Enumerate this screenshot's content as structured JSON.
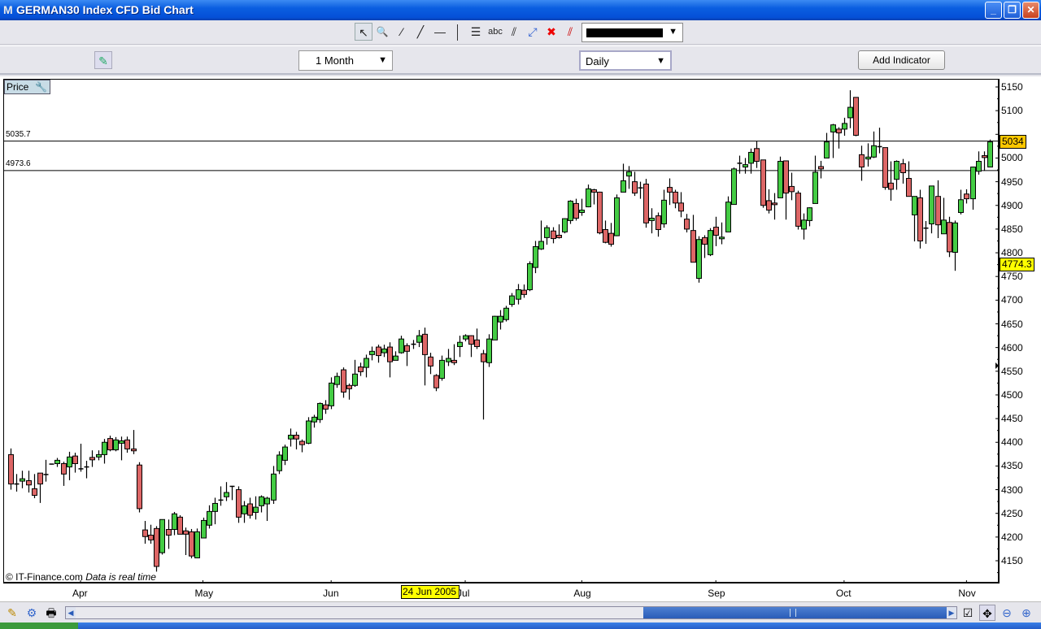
{
  "window": {
    "title": "GERMAN30 Index CFD Bid Chart",
    "minimize": "_",
    "restore": "❐",
    "close": "✕"
  },
  "toolbar": {
    "tools": [
      {
        "name": "pointer-icon",
        "glyph": "↖"
      },
      {
        "name": "zoom-icon",
        "glyph": "🔍"
      },
      {
        "name": "short-line-icon",
        "glyph": "⁄"
      },
      {
        "name": "trend-line-icon",
        "glyph": "╱"
      },
      {
        "name": "horizontal-line-icon",
        "glyph": "—"
      },
      {
        "name": "fibonacci-icon",
        "glyph": "☰"
      },
      {
        "name": "text-tool-icon",
        "glyph": "abc"
      },
      {
        "name": "parallel-lines-icon",
        "glyph": "⫽"
      },
      {
        "name": "line-points-icon",
        "glyph": "⤢"
      },
      {
        "name": "delete-icon",
        "glyph": "✖"
      },
      {
        "name": "delete-all-lines-icon",
        "glyph": "⫽"
      }
    ],
    "line_color": "#000000"
  },
  "toolbar2": {
    "period": "1 Month",
    "interval": "Daily",
    "add_indicator": "Add Indicator"
  },
  "chart": {
    "pane_label": "Price",
    "hline_labels": [
      "5035.7",
      "4973.6"
    ],
    "current_price_label": "5034",
    "cursor_price_label": "4774.3",
    "date_tooltip": "24 Jun 2005",
    "copyright": "© IT-Finance.com",
    "realtime_note": "Data is real time",
    "colors": {
      "up": "#44cc44",
      "down": "#dd6666",
      "current": "#ffc800",
      "cursor": "#ffff00"
    }
  },
  "chart_data": {
    "type": "candlestick",
    "title": "GERMAN30 Index CFD Bid Chart",
    "ylim": [
      4125,
      5175
    ],
    "yticks": [
      4150,
      4200,
      4250,
      4300,
      4350,
      4400,
      4450,
      4500,
      4550,
      4600,
      4650,
      4700,
      4750,
      4800,
      4850,
      4900,
      4950,
      5000,
      5050,
      5100,
      5150
    ],
    "xticks": [
      {
        "label": "Apr",
        "index": 12
      },
      {
        "label": "May",
        "index": 33
      },
      {
        "label": "Jun",
        "index": 55
      },
      {
        "label": "Jul",
        "index": 78
      },
      {
        "label": "Aug",
        "index": 98
      },
      {
        "label": "Sep",
        "index": 121
      },
      {
        "label": "Oct",
        "index": 143
      },
      {
        "label": "Nov",
        "index": 164
      }
    ],
    "hlines": [
      5035.7,
      4973.6
    ],
    "ohlc": [
      [
        4374,
        4387,
        4300,
        4312
      ],
      [
        4312,
        4333,
        4296,
        4312
      ],
      [
        4318,
        4340,
        4303,
        4323
      ],
      [
        4319,
        4340,
        4294,
        4310
      ],
      [
        4302,
        4333,
        4282,
        4288
      ],
      [
        4335,
        4335,
        4272,
        4312
      ],
      [
        4332,
        4363,
        4317,
        4332
      ],
      [
        4354,
        4355,
        4353,
        4354
      ],
      [
        4355,
        4367,
        4348,
        4362
      ],
      [
        4355,
        4359,
        4308,
        4333
      ],
      [
        4348,
        4380,
        4320,
        4369
      ],
      [
        4371,
        4378,
        4336,
        4355
      ],
      [
        4344,
        4397,
        4338,
        4344
      ],
      [
        4348,
        4361,
        4324,
        4348
      ],
      [
        4368,
        4383,
        4348,
        4363
      ],
      [
        4369,
        4383,
        4362,
        4374
      ],
      [
        4374,
        4407,
        4355,
        4400
      ],
      [
        4408,
        4414,
        4381,
        4384
      ],
      [
        4384,
        4411,
        4381,
        4405
      ],
      [
        4398,
        4412,
        4362,
        4403
      ],
      [
        4405,
        4412,
        4378,
        4386
      ],
      [
        4386,
        4426,
        4375,
        4382
      ],
      [
        4352,
        4358,
        4252,
        4260
      ],
      [
        4215,
        4234,
        4186,
        4201
      ],
      [
        4204,
        4226,
        4186,
        4194
      ],
      [
        4218,
        4223,
        4127,
        4138
      ],
      [
        4167,
        4237,
        4163,
        4237
      ],
      [
        4216,
        4237,
        4175,
        4204
      ],
      [
        4216,
        4253,
        4204,
        4249
      ],
      [
        4242,
        4246,
        4206,
        4206
      ],
      [
        4213,
        4220,
        4162,
        4206
      ],
      [
        4211,
        4217,
        4155,
        4160
      ],
      [
        4156,
        4218,
        4156,
        4211
      ],
      [
        4198,
        4241,
        4198,
        4235
      ],
      [
        4225,
        4267,
        4218,
        4254
      ],
      [
        4254,
        4283,
        4227,
        4271
      ],
      [
        4278,
        4307,
        4266,
        4278
      ],
      [
        4285,
        4316,
        4276,
        4294
      ],
      [
        4307,
        4308,
        4278,
        4307
      ],
      [
        4300,
        4307,
        4230,
        4242
      ],
      [
        4249,
        4276,
        4230,
        4266
      ],
      [
        4270,
        4283,
        4239,
        4246
      ],
      [
        4252,
        4286,
        4237,
        4263
      ],
      [
        4266,
        4288,
        4252,
        4285
      ],
      [
        4270,
        4285,
        4234,
        4282
      ],
      [
        4278,
        4350,
        4270,
        4333
      ],
      [
        4340,
        4381,
        4333,
        4373
      ],
      [
        4362,
        4395,
        4352,
        4390
      ],
      [
        4407,
        4429,
        4391,
        4415
      ],
      [
        4415,
        4422,
        4385,
        4407
      ],
      [
        4402,
        4406,
        4379,
        4395
      ],
      [
        4398,
        4453,
        4396,
        4445
      ],
      [
        4443,
        4458,
        4431,
        4453
      ],
      [
        4448,
        4484,
        4441,
        4482
      ],
      [
        4479,
        4489,
        4460,
        4470
      ],
      [
        4477,
        4537,
        4470,
        4525
      ],
      [
        4522,
        4547,
        4515,
        4539
      ],
      [
        4553,
        4558,
        4494,
        4506
      ],
      [
        4520,
        4524,
        4490,
        4513
      ],
      [
        4520,
        4574,
        4517,
        4544
      ],
      [
        4559,
        4568,
        4540,
        4549
      ],
      [
        4558,
        4585,
        4537,
        4577
      ],
      [
        4585,
        4602,
        4573,
        4592
      ],
      [
        4601,
        4606,
        4568,
        4583
      ],
      [
        4589,
        4606,
        4580,
        4597
      ],
      [
        4601,
        4611,
        4537,
        4570
      ],
      [
        4573,
        4592,
        4573,
        4582
      ],
      [
        4589,
        4625,
        4587,
        4618
      ],
      [
        4604,
        4609,
        4561,
        4592
      ],
      [
        4607,
        4616,
        4597,
        4607
      ],
      [
        4611,
        4637,
        4601,
        4625
      ],
      [
        4628,
        4642,
        4520,
        4585
      ],
      [
        4580,
        4589,
        4544,
        4561
      ],
      [
        4541,
        4544,
        4508,
        4515
      ],
      [
        4535,
        4583,
        4530,
        4573
      ],
      [
        4570,
        4597,
        4561,
        4577
      ],
      [
        4573,
        4607,
        4563,
        4568
      ],
      [
        4602,
        4625,
        4580,
        4611
      ],
      [
        4618,
        4628,
        4613,
        4625
      ],
      [
        4625,
        4626,
        4580,
        4607
      ],
      [
        4616,
        4640,
        4597,
        4602
      ],
      [
        4587,
        4595,
        4448,
        4570
      ],
      [
        4568,
        4628,
        4559,
        4618
      ],
      [
        4616,
        4667,
        4616,
        4666
      ],
      [
        4654,
        4679,
        4638,
        4666
      ],
      [
        4659,
        4688,
        4655,
        4683
      ],
      [
        4691,
        4715,
        4686,
        4709
      ],
      [
        4702,
        4734,
        4691,
        4722
      ],
      [
        4721,
        4733,
        4705,
        4712
      ],
      [
        4722,
        4782,
        4719,
        4777
      ],
      [
        4769,
        4825,
        4757,
        4813
      ],
      [
        4808,
        4868,
        4806,
        4824
      ],
      [
        4832,
        4858,
        4817,
        4853
      ],
      [
        4846,
        4854,
        4820,
        4830
      ],
      [
        4837,
        4860,
        4830,
        4832
      ],
      [
        4844,
        4873,
        4841,
        4872
      ],
      [
        4868,
        4911,
        4861,
        4909
      ],
      [
        4904,
        4914,
        4868,
        4873
      ],
      [
        4885,
        4914,
        4878,
        4890
      ],
      [
        4897,
        4944,
        4896,
        4935
      ],
      [
        4933,
        4935,
        4902,
        4928
      ],
      [
        4928,
        4929,
        4839,
        4842
      ],
      [
        4849,
        4868,
        4820,
        4822
      ],
      [
        4841,
        4863,
        4813,
        4818
      ],
      [
        4836,
        4923,
        4835,
        4916
      ],
      [
        4928,
        4988,
        4928,
        4952
      ],
      [
        4962,
        4983,
        4935,
        4971
      ],
      [
        4950,
        4971,
        4920,
        4926
      ],
      [
        4937,
        4950,
        4914,
        4937
      ],
      [
        4945,
        4956,
        4853,
        4863
      ],
      [
        4868,
        4894,
        4841,
        4873
      ],
      [
        4878,
        4885,
        4834,
        4849
      ],
      [
        4861,
        4933,
        4853,
        4911
      ],
      [
        4938,
        4957,
        4901,
        4928
      ],
      [
        4928,
        4933,
        4894,
        4905
      ],
      [
        4905,
        4928,
        4875,
        4888
      ],
      [
        4871,
        4882,
        4843,
        4850
      ],
      [
        4847,
        4880,
        4780,
        4780
      ],
      [
        4746,
        4835,
        4737,
        4828
      ],
      [
        4832,
        4837,
        4789,
        4818
      ],
      [
        4796,
        4852,
        4793,
        4847
      ],
      [
        4854,
        4876,
        4814,
        4837
      ],
      [
        4830,
        4864,
        4818,
        4833
      ],
      [
        4844,
        4919,
        4844,
        4907
      ],
      [
        4902,
        4980,
        4902,
        4977
      ],
      [
        4989,
        5005,
        4967,
        4989
      ],
      [
        4981,
        5000,
        4967,
        4986
      ],
      [
        4989,
        5020,
        4967,
        5012
      ],
      [
        5020,
        5036,
        4979,
        4993
      ],
      [
        4996,
        4996,
        4895,
        4900
      ],
      [
        4910,
        4934,
        4883,
        4890
      ],
      [
        4905,
        4926,
        4870,
        4902
      ],
      [
        4916,
        5003,
        4916,
        4993
      ],
      [
        4994,
        4994,
        4870,
        4926
      ],
      [
        4940,
        4969,
        4911,
        4929
      ],
      [
        4926,
        4931,
        4849,
        4856
      ],
      [
        4850,
        4883,
        4828,
        4869
      ],
      [
        4868,
        4896,
        4856,
        4895
      ],
      [
        4904,
        5005,
        4904,
        4970
      ],
      [
        4982,
        4994,
        4957,
        4977
      ],
      [
        5000,
        5053,
        5000,
        5034
      ],
      [
        5055,
        5072,
        5000,
        5070
      ],
      [
        5061,
        5065,
        5020,
        5053
      ],
      [
        5061,
        5085,
        5047,
        5073
      ],
      [
        5085,
        5143,
        5063,
        5107
      ],
      [
        5128,
        5128,
        5046,
        5048
      ],
      [
        5007,
        5026,
        4952,
        4981
      ],
      [
        4998,
        5031,
        4982,
        5002
      ],
      [
        5002,
        5056,
        5000,
        5026
      ],
      [
        5024,
        5064,
        5010,
        5024
      ],
      [
        5022,
        5022,
        4933,
        4938
      ],
      [
        4947,
        4993,
        4910,
        4934
      ],
      [
        4955,
        4995,
        4933,
        4993
      ],
      [
        4988,
        4998,
        4946,
        4969
      ],
      [
        4957,
        4993,
        4919,
        4919
      ],
      [
        4880,
        4919,
        4824,
        4919
      ],
      [
        4916,
        4933,
        4809,
        4825
      ],
      [
        4852,
        4867,
        4819,
        4852
      ],
      [
        4861,
        4941,
        4841,
        4941
      ],
      [
        4919,
        4953,
        4831,
        4859
      ],
      [
        4840,
        4916,
        4840,
        4869
      ],
      [
        4864,
        4876,
        4791,
        4802
      ],
      [
        4801,
        4868,
        4762,
        4863
      ],
      [
        4885,
        4933,
        4881,
        4912
      ],
      [
        4924,
        4934,
        4904,
        4914
      ],
      [
        4914,
        4982,
        4891,
        4981
      ],
      [
        4972,
        5014,
        4965,
        4993
      ],
      [
        5005,
        5014,
        4973,
        5001
      ],
      [
        4981,
        5039,
        4981,
        5034
      ]
    ]
  },
  "bottombar": {
    "left_icons": [
      "draw-settings-icon",
      "chart-properties-icon",
      "print-icon"
    ],
    "right_icons": [
      "checklist-icon",
      "pan-icon",
      "zoom-out-icon",
      "zoom-in-icon"
    ]
  }
}
